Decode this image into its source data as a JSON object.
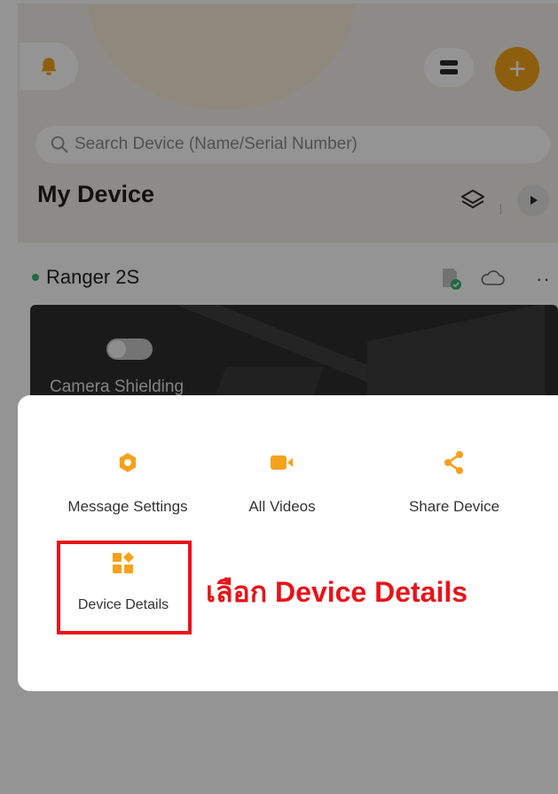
{
  "header": {
    "bell_icon": "bell-icon",
    "menu_icon": "menu-icon",
    "add_icon": "plus-icon",
    "add_label": "+"
  },
  "search": {
    "placeholder": "Search Device (Name/Serial Number)"
  },
  "main": {
    "title": "My Device",
    "device": {
      "name": "Ranger 2S",
      "status_color": "#3cb371",
      "overlay_label": "Camera Shielding",
      "more_label": "··"
    }
  },
  "action_sheet": {
    "items": [
      {
        "label": "Message Settings",
        "icon": "gear-hex-icon"
      },
      {
        "label": "All Videos",
        "icon": "video-camera-icon"
      },
      {
        "label": "Share Device",
        "icon": "share-icon"
      },
      {
        "label": "Device Details",
        "icon": "grid-details-icon"
      }
    ]
  },
  "annotation": {
    "callout": "เลือก Device Details"
  },
  "colors": {
    "accent": "#f5a21b",
    "highlight": "#e8131a"
  }
}
